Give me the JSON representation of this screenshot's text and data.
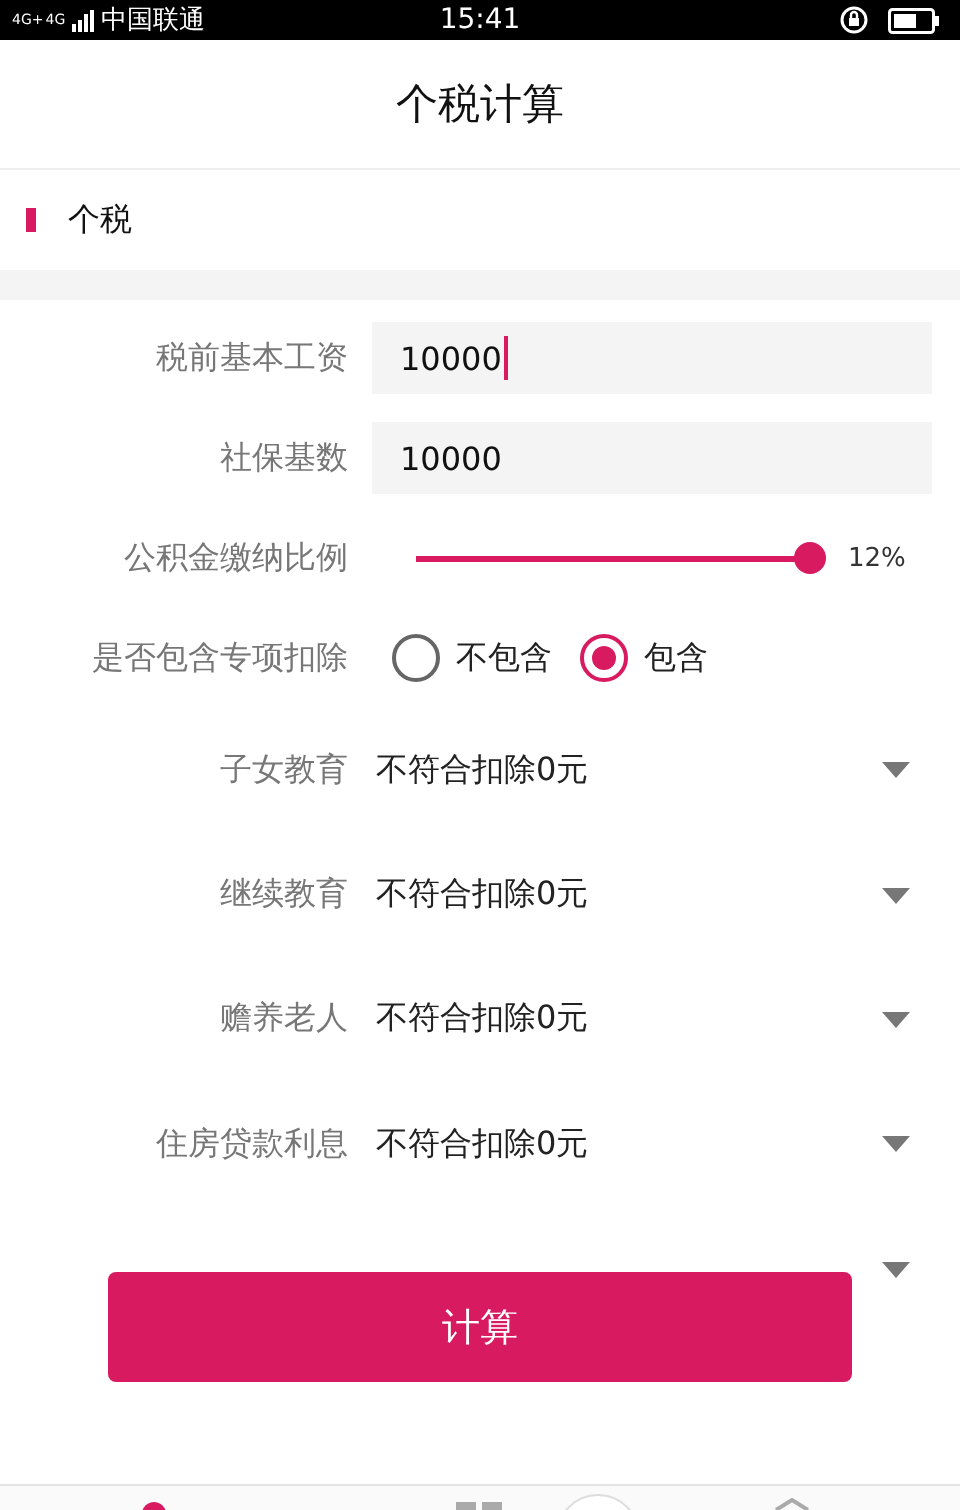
{
  "status_bar": {
    "networks": [
      "4G+",
      "4G"
    ],
    "carrier": "中国联通",
    "time": "15:41"
  },
  "header": {
    "title": "个税计算"
  },
  "section": {
    "title": "个税"
  },
  "form": {
    "inputs": [
      {
        "label": "税前基本工资",
        "value": "10000",
        "focused": true
      },
      {
        "label": "社保基数",
        "value": "10000",
        "focused": false
      }
    ],
    "slider": {
      "label": "公积金缴纳比例",
      "level": 1,
      "reading": "12%"
    },
    "radio": {
      "label": "是否包含专项扣除",
      "options": [
        {
          "label": "不包含",
          "selected": false
        },
        {
          "label": "包含",
          "selected": true
        }
      ]
    },
    "dropdowns": [
      {
        "label": "子女教育",
        "value": "不符合扣除0元"
      },
      {
        "label": "继续教育",
        "value": "不符合扣除0元"
      },
      {
        "label": "赡养老人",
        "value": "不符合扣除0元"
      },
      {
        "label": "住房贷款利息",
        "value": "不符合扣除0元"
      }
    ]
  },
  "button": {
    "label": "计算"
  }
}
